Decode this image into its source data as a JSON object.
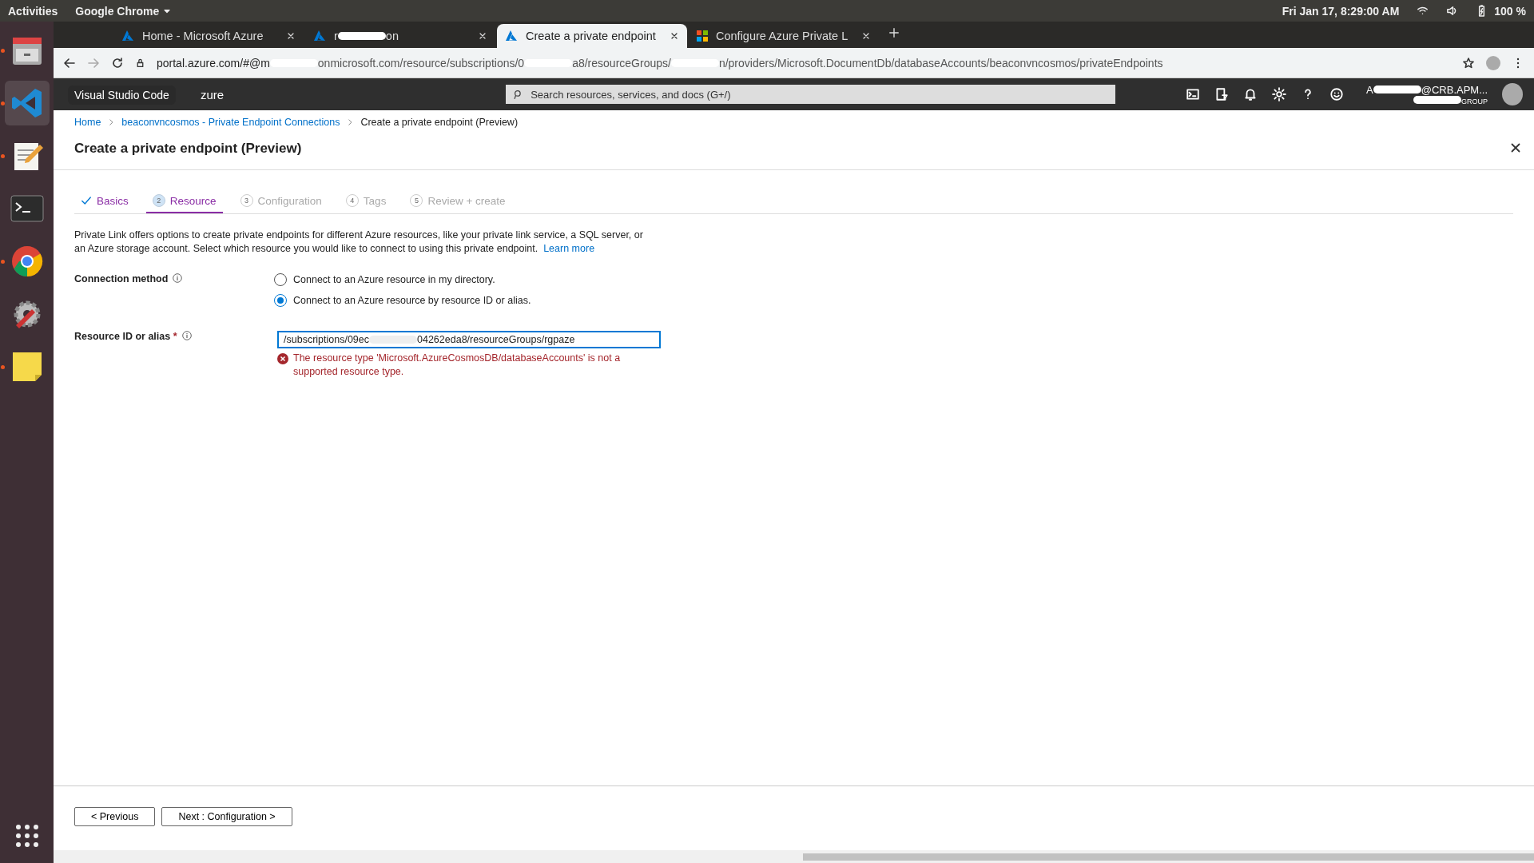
{
  "topbar": {
    "activities": "Activities",
    "app": "Google Chrome",
    "clock": "Fri Jan 17,  8:29:00 AM",
    "battery": "100 %"
  },
  "browser_tabs": [
    {
      "title": [
        "Home - Microsoft Azure"
      ],
      "kind": "azure",
      "selected": false
    },
    {
      "title": [
        "r",
        "on"
      ],
      "kind": "azure",
      "selected": false
    },
    {
      "title": [
        "Create a private endpoint"
      ],
      "kind": "azure",
      "selected": true
    },
    {
      "title": [
        "Configure Azure Private L"
      ],
      "kind": "windows",
      "selected": false
    }
  ],
  "address": {
    "segments": [
      "portal.azure.com/#@m",
      "onmicrosoft.com/resource/subscriptions/0",
      "a8/resourceGroups/",
      "n/providers/Microsoft.DocumentDb/databaseAccounts/beaconvncosmos/privateEndpoints"
    ]
  },
  "dock": {
    "tooltip": "Visual Studio Code",
    "apps": [
      {
        "kind": "files",
        "running": true
      },
      {
        "kind": "vscode",
        "running": true
      },
      {
        "kind": "editor",
        "running": true
      },
      {
        "kind": "terminal",
        "running": false
      },
      {
        "kind": "chrome",
        "running": true
      },
      {
        "kind": "tools",
        "running": false
      },
      {
        "kind": "notes",
        "running": true
      }
    ]
  },
  "portal_header": {
    "brand": "zure",
    "search": {
      "placeholder": "Search resources, services, and docs (G+/)"
    },
    "user": [
      "A",
      "@CRB.APM..."
    ],
    "directory": "GROUP"
  },
  "breadcrumb": [
    {
      "label": "Home",
      "link": true
    },
    {
      "label": "beaconvncosmos - Private Endpoint Connections",
      "link": true
    },
    {
      "label": "Create a private endpoint (Preview)",
      "link": false
    }
  ],
  "title": "Create a private endpoint (Preview)",
  "steps": [
    {
      "label": "Basics",
      "done": true,
      "selected": false
    },
    {
      "number": "2",
      "label": "Resource",
      "done": false,
      "selected": true
    },
    {
      "number": "3",
      "label": "Configuration",
      "done": false,
      "selected": false
    },
    {
      "number": "4",
      "label": "Tags",
      "done": false,
      "selected": false
    },
    {
      "number": "5",
      "label": "Review + create",
      "done": false,
      "selected": false
    }
  ],
  "description": "Private Link offers options to create private endpoints for different Azure resources, like your private link service, a SQL server, or an Azure storage account. Select which resource you would like to connect to using this private endpoint.",
  "learn_more": "Learn more",
  "connection_method": {
    "label": "Connection method",
    "options": [
      {
        "label": "Connect to an Azure resource in my directory.",
        "selected": false
      },
      {
        "label": "Connect to an Azure resource by resource ID or alias.",
        "selected": true
      }
    ]
  },
  "resource_id": {
    "label": "Resource ID or alias",
    "required": "*",
    "value": [
      "/subscriptions/09ec",
      "04262eda8/resourceGroups/rgpaze"
    ],
    "error": "The resource type 'Microsoft.AzureCosmosDB/databaseAccounts' is not a supported resource type."
  },
  "buttons": [
    "< Previous",
    "Next : Configuration >"
  ]
}
